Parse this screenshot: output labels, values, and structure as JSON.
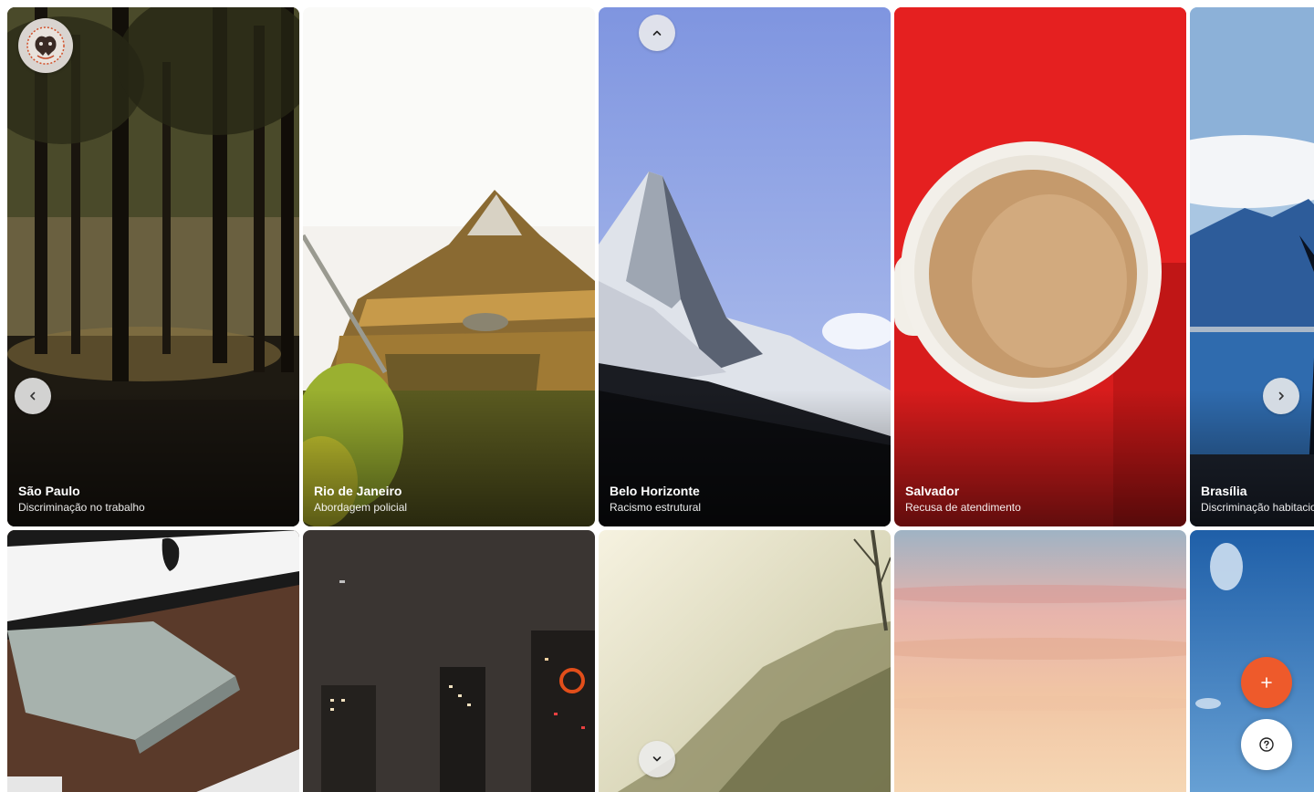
{
  "cards": [
    {
      "city": "São Paulo",
      "issue": "Discriminação no trabalho",
      "image": "forest-park"
    },
    {
      "city": "Rio de Janeiro",
      "issue": "Abordagem policial",
      "image": "canoe"
    },
    {
      "city": "Belo Horizonte",
      "issue": "Racismo estrutural",
      "image": "mountain"
    },
    {
      "city": "Salvador",
      "issue": "Recusa de atendimento",
      "image": "coffee-cup"
    },
    {
      "city": "Brasília",
      "issue": "Discriminação habitacional",
      "image": "lake-mountains"
    }
  ],
  "second_row_images": [
    "desk-computer",
    "city-night",
    "foggy-hill",
    "sunset-sky",
    "blue-sky"
  ],
  "buttons": {
    "logo_icon": "emblem-icon",
    "prev_icon": "chevron-left-icon",
    "next_icon": "chevron-right-icon",
    "up_icon": "chevron-up-icon",
    "down_icon": "chevron-down-icon",
    "add_icon": "plus-icon",
    "help_icon": "help-circle-icon"
  },
  "colors": {
    "accent": "#ee5a2b",
    "caption_text": "#ffffff"
  }
}
